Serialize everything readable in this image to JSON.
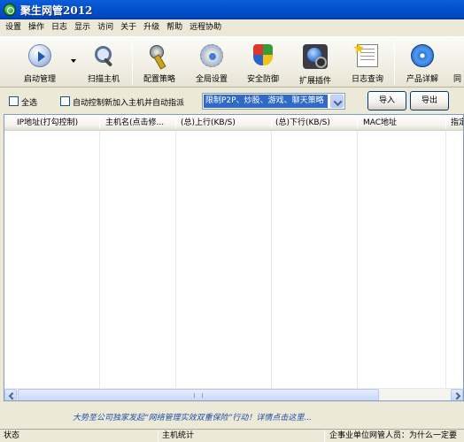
{
  "window": {
    "title": "聚生网管2012"
  },
  "menu": [
    "设置",
    "操作",
    "日志",
    "显示",
    "访问",
    "关于",
    "升级",
    "帮助",
    "远程协助"
  ],
  "toolbar": [
    {
      "label": "启动管理",
      "icon": "play-icon"
    },
    {
      "label": "扫描主机",
      "icon": "magnifier-icon"
    },
    {
      "label": "配置策略",
      "icon": "key-icon"
    },
    {
      "label": "全局设置",
      "icon": "gear-icon"
    },
    {
      "label": "安全防御",
      "icon": "shield-icon"
    },
    {
      "label": "扩展插件",
      "icon": "plugin-icon"
    },
    {
      "label": "日志查询",
      "icon": "log-icon"
    },
    {
      "label": "产品详解",
      "icon": "disc-icon"
    },
    {
      "label": "同",
      "icon": "more-icon"
    }
  ],
  "options": {
    "select_all": "全选",
    "auto_control": "自动控制新加入主机并自动指派",
    "policy_select_value": "限制P2P、炒股、游戏、聊天策略",
    "import_label": "导入",
    "export_label": "导出"
  },
  "host_table": {
    "columns": [
      "IP地址(打勾控制)",
      "主机名(点击修...",
      "(总)上行(KB/S)",
      "(总)下行(KB/S)",
      "MAC地址",
      "指定"
    ],
    "rows": []
  },
  "promo_text": "大势至公司独家发起“网络管理实效双重保险”行动！详情点击这里...",
  "status_bar": {
    "status": "状态",
    "host_stats": "主机统计",
    "message": "企事业单位网管人员：为什么一定要"
  }
}
